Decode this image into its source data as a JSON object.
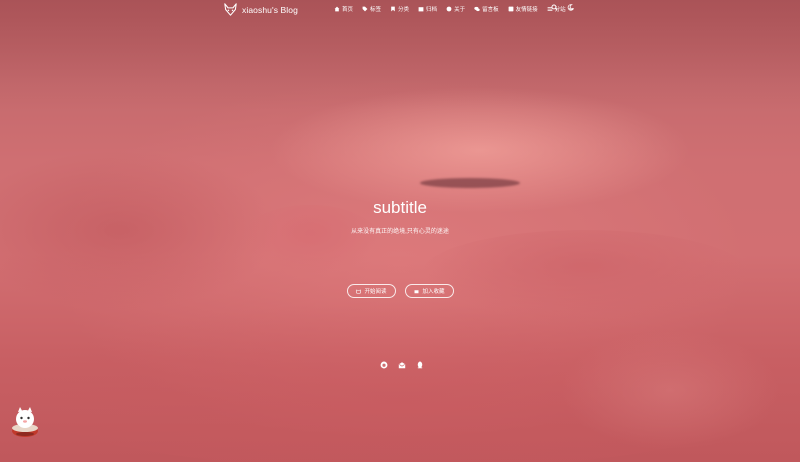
{
  "brand": {
    "title": "xiaoshu's Blog",
    "logo_icon": "fox-icon"
  },
  "nav": {
    "items": [
      {
        "label": "首页",
        "icon": "home-icon"
      },
      {
        "label": "标签",
        "icon": "tag-icon"
      },
      {
        "label": "分类",
        "icon": "bookmark-icon"
      },
      {
        "label": "归档",
        "icon": "archive-icon"
      },
      {
        "label": "关于",
        "icon": "user-icon"
      },
      {
        "label": "留言板",
        "icon": "comment-icon"
      },
      {
        "label": "友情链接",
        "icon": "link-icon"
      },
      {
        "label": "分站",
        "icon": "list-icon",
        "dropdown": true
      }
    ],
    "tools": [
      "search-icon",
      "moon-icon"
    ]
  },
  "hero": {
    "title": "subtitle",
    "subtitle": "从来没有真正的绝境,只有心灵的迷途",
    "read_button": "开始阅读",
    "collect_button": "加入收藏"
  },
  "socials": [
    "github-icon",
    "mail-icon",
    "qq-icon"
  ],
  "colors": {
    "accent": "#cf6f72",
    "text": "#ffffff"
  }
}
